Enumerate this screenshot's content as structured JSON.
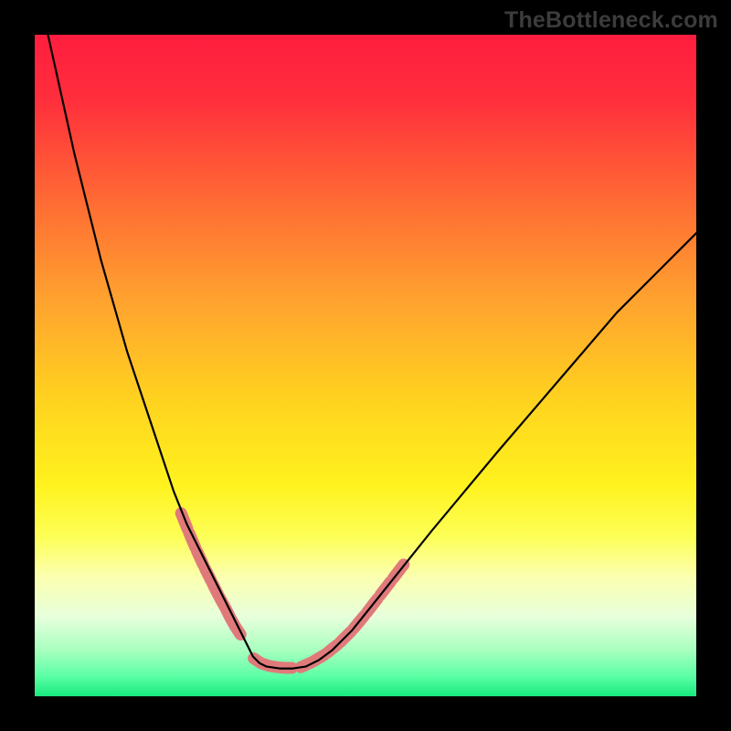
{
  "watermark": "TheBottleneck.com",
  "chart_data": {
    "type": "line",
    "title": "",
    "xlabel": "",
    "ylabel": "",
    "xlim": [
      0,
      100
    ],
    "ylim": [
      0,
      100
    ],
    "gradient_stops": [
      {
        "offset": 0.0,
        "color": "#ff1d3f"
      },
      {
        "offset": 0.1,
        "color": "#ff2f3c"
      },
      {
        "offset": 0.25,
        "color": "#ff6a34"
      },
      {
        "offset": 0.4,
        "color": "#ffa22f"
      },
      {
        "offset": 0.55,
        "color": "#ffd21f"
      },
      {
        "offset": 0.68,
        "color": "#fff21e"
      },
      {
        "offset": 0.76,
        "color": "#fdff58"
      },
      {
        "offset": 0.82,
        "color": "#fbffb0"
      },
      {
        "offset": 0.88,
        "color": "#e7ffdc"
      },
      {
        "offset": 0.93,
        "color": "#a8ffbf"
      },
      {
        "offset": 0.97,
        "color": "#5bffa5"
      },
      {
        "offset": 1.0,
        "color": "#18e87e"
      }
    ],
    "series": [
      {
        "name": "bottleneck-curve",
        "x": [
          2,
          6,
          10,
          14,
          18,
          21,
          23,
          25,
          27,
          29,
          30.5,
          32,
          33,
          34,
          35,
          37,
          39,
          41,
          43,
          45,
          48,
          52,
          56,
          60,
          65,
          70,
          76,
          82,
          88,
          94,
          100
        ],
        "y": [
          100,
          82,
          66,
          52,
          40,
          31,
          26,
          22,
          18,
          14,
          11,
          8,
          6,
          5,
          4.5,
          4.2,
          4.2,
          4.5,
          5.5,
          7,
          10,
          15,
          20,
          25,
          31,
          37,
          44,
          51,
          58,
          64,
          70
        ]
      }
    ],
    "dash_segments_left": {
      "indices_range": "points along left descending arm with y between roughly 11 and 30",
      "x": [
        22.0,
        23.2,
        24.4,
        25.6,
        26.8,
        27.8,
        28.8,
        29.6,
        30.4,
        31.2
      ],
      "y": [
        28.0,
        25.0,
        22.2,
        19.6,
        17.2,
        15.2,
        13.4,
        11.8,
        10.4,
        9.2
      ]
    },
    "dash_segments_right": {
      "indices_range": "points along right ascending arm with y between roughly 5 and 30",
      "x": [
        40.0,
        42.0,
        44.0,
        46.0,
        48.0,
        50.0,
        52.0,
        54.0,
        56.0
      ],
      "y": [
        4.3,
        5.2,
        6.4,
        8.0,
        10.0,
        12.4,
        15.0,
        17.6,
        20.2
      ]
    },
    "dash_segments_bottom": {
      "indices_range": "flat valley floor",
      "x": [
        33.0,
        34.2,
        35.4,
        36.6,
        37.8,
        39.0
      ],
      "y": [
        5.8,
        5.0,
        4.6,
        4.4,
        4.3,
        4.3
      ]
    },
    "dash_style": {
      "color": "#e07a7a",
      "width": 13,
      "cap": "round"
    },
    "curve_style": {
      "color": "#000000",
      "width": 2.2
    }
  }
}
